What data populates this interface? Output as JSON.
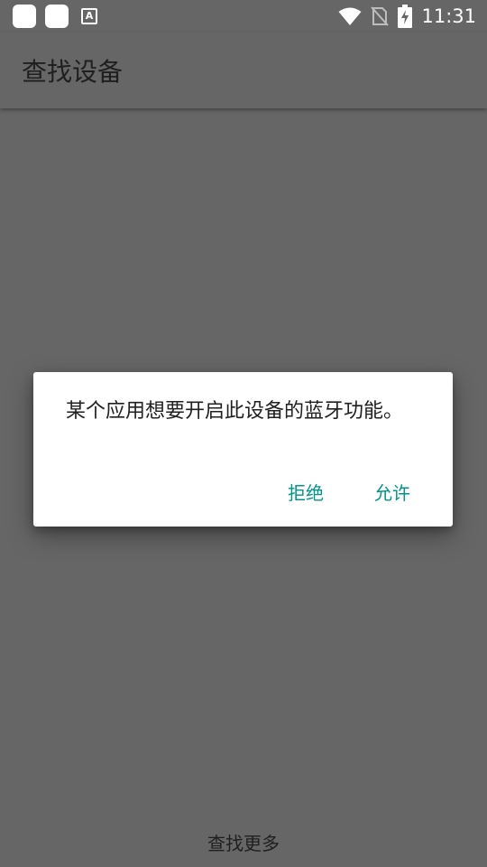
{
  "status_bar": {
    "time": "11:31",
    "notification_icons": [
      "app-notification-icon",
      "app-notification-icon",
      "font-a-icon"
    ],
    "system_icons": [
      "wifi-icon",
      "no-sim-icon",
      "battery-charging-icon"
    ]
  },
  "app_bar": {
    "title": "查找设备"
  },
  "dialog": {
    "message": "某个应用想要开启此设备的蓝牙功能。",
    "deny_label": "拒绝",
    "allow_label": "允许",
    "accent_color": "#009688"
  },
  "footer": {
    "find_more_label": "查找更多"
  }
}
